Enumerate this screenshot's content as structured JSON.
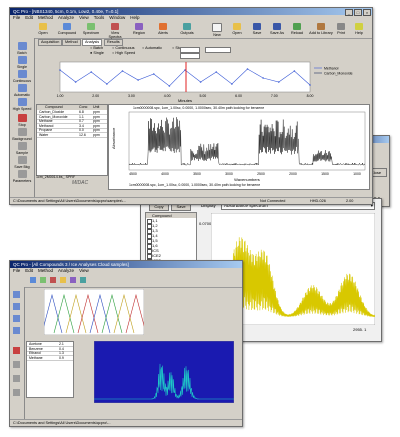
{
  "main": {
    "title": "QC Pro - [NBS1340, 5cm, 0.1m, Low2, 0.40e, T=0.1]",
    "menu": [
      "File",
      "Edit",
      "Method",
      "Analyze",
      "View",
      "Tools",
      "Window",
      "Help"
    ],
    "toolbar_left": [
      "Open",
      "Compound",
      "Spectrum",
      "View Spectra",
      "Region",
      "Alerts",
      "Outputs"
    ],
    "toolbar_right": [
      "New",
      "Open",
      "Save",
      "Save As",
      "Reload",
      "Add to Library",
      "Print",
      "Help"
    ],
    "sidebar": [
      "Batch",
      "Single",
      "Continuous",
      "Automatic",
      "High Speed",
      "Stop",
      "Background",
      "Sample",
      "Save Bkg",
      "Parameters"
    ],
    "tabs": [
      "Acquisition",
      "Method",
      "Analysis",
      "Results"
    ],
    "radio_options": [
      "Batch",
      "Single",
      "Continuous",
      "Automatic",
      "Stop",
      "High Speed"
    ],
    "trend_x_label": "Minutes",
    "trend_x_ticks": [
      "1.00",
      "2.00",
      "3.00",
      "4.00",
      "5.00",
      "6.00",
      "7.00",
      "8.00"
    ],
    "legend": [
      "Methanol",
      "Carbon_Monoxide"
    ],
    "results_headers": [
      "Compound",
      "Conc",
      "Unit"
    ],
    "results_rows": [
      [
        "Carbon_Dioxide",
        "6.8",
        "ppm"
      ],
      [
        "Carbon_Monoxide",
        "1.1",
        "ppm"
      ],
      [
        "Methane",
        "0.7",
        "ppm"
      ],
      [
        "Methanol",
        "3.4",
        "ppm"
      ],
      [
        "Propane",
        "0.0",
        "ppm"
      ],
      [
        "Water",
        "12.6",
        "ppm"
      ]
    ],
    "spectrum_title": "1cm0000008.spc, 1cm_1.00sc, 0.0000, 1.0000sec, 30.40m path looking for benzene",
    "spectrum_y_label": "Absorbance",
    "spectrum_x_label": "Wavenumbers",
    "spectrum_x_ticks": [
      "4500",
      "4000",
      "3500",
      "3000",
      "2500",
      "2000",
      "1500",
      "1000"
    ],
    "spectrum_bottom_caption": "1cm0000008.spc, 1cm_1.00sc, 0.0000, 1.0000sec, 30.40m path looking for benzene",
    "status_left": "C:\\Documents and Settings\\All Users\\Documents\\qcpro\\samples\\...",
    "status_right": [
      "Not Connected",
      "HHD-026",
      "2.00"
    ],
    "file_label": "1cm_2M0014.bs_ SPRF",
    "logo": "MIDAC"
  },
  "mid": {
    "buttons": [
      "Copy",
      "Save"
    ],
    "compound_header": "Compound",
    "compounds": [
      "1,1",
      "1,2",
      "1,3",
      "1,4",
      "1,5",
      "1,6",
      "ICS",
      "ICE2",
      "ICE3",
      "ICE4",
      "ICF",
      "OC",
      "OC SF6 AN"
    ],
    "display_label": "Display",
    "display_value": "Absorbance spectrum",
    "y_top": "0.0700",
    "y_bottom": "0.0100",
    "x_left": "2400. 5",
    "x_right": "2955. 1"
  },
  "back": {
    "date": "10/22/96",
    "button": "Close",
    "value": "419.6"
  },
  "small": {
    "title": "QC Pro - [All Compounds 3 / Ice Analyses Cloud samples]",
    "rows": [
      [
        "Acetone",
        "2.1"
      ],
      [
        "Benzene",
        "0.4"
      ],
      [
        "Ethanol",
        "1.3"
      ],
      [
        "Methane",
        "0.9"
      ]
    ],
    "status": "C:\\Documents and Settings\\All Users\\Documents\\qcpro\\..."
  },
  "colors": {
    "titlebar": "#0a246a",
    "trend_line": "#3b5bd6",
    "cursor": "#e02020",
    "yellow_trace": "#d8c800",
    "cyan_trace": "#1ec8c8"
  }
}
